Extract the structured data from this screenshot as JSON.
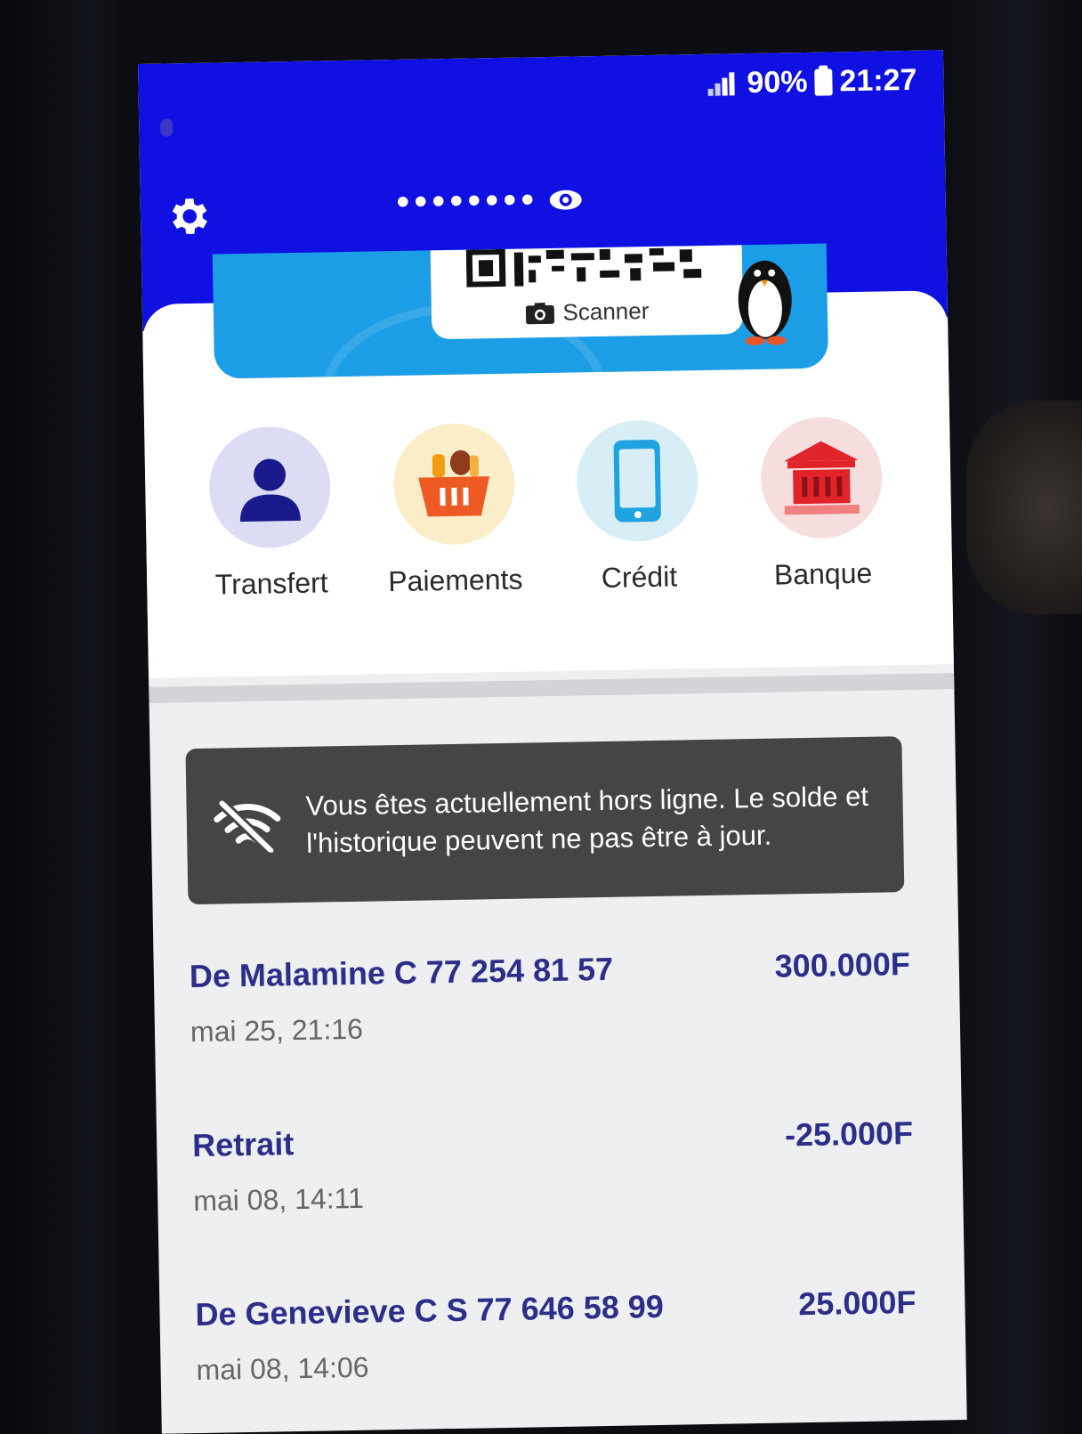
{
  "status_bar": {
    "battery": "90%",
    "time": "21:27"
  },
  "header": {
    "balance_mask": "••••••••"
  },
  "banner": {
    "scanner_label": "Scanner"
  },
  "actions": [
    {
      "label": "Transfert",
      "icon": "user-icon",
      "bg": "#dcdcf4",
      "color": "#1a1a8c"
    },
    {
      "label": "Paiements",
      "icon": "basket-icon",
      "bg": "#faedc8",
      "color": "#ee5a24"
    },
    {
      "label": "Crédit",
      "icon": "phone-icon",
      "bg": "#d8eef7",
      "color": "#1fa3e0"
    },
    {
      "label": "Banque",
      "icon": "bank-icon",
      "bg": "#f6dede",
      "color": "#e0242a"
    }
  ],
  "offline_notice": {
    "text": "Vous êtes actuellement hors ligne. Le solde et l'historique peuvent ne pas être à jour."
  },
  "transactions": [
    {
      "name": "De Malamine C 77 254 81 57",
      "amount": "300.000F",
      "date": "mai 25, 21:16"
    },
    {
      "name": "Retrait",
      "amount": "-25.000F",
      "date": "mai 08, 14:11"
    },
    {
      "name": "De Genevieve C S 77 646 58 99",
      "amount": "25.000F",
      "date": "mai 08, 14:06"
    }
  ],
  "colors": {
    "header_blue": "#1010e2",
    "banner_blue": "#1c9ee6",
    "transaction_text": "#2d2d8a"
  }
}
